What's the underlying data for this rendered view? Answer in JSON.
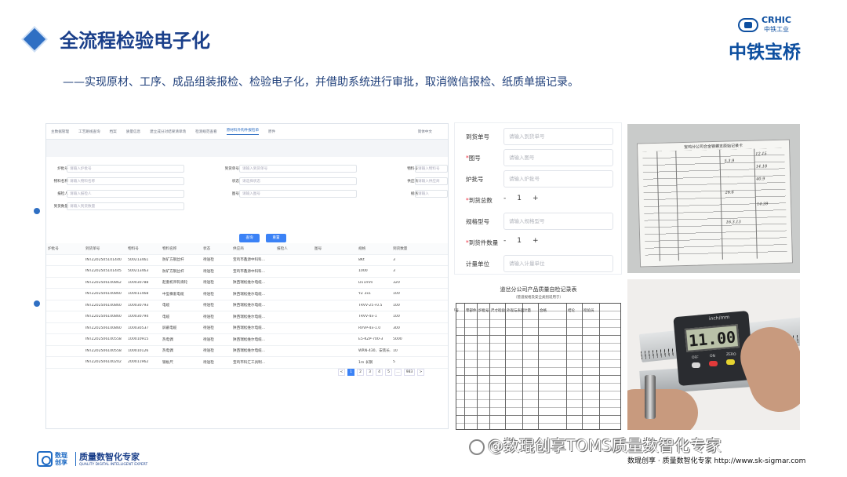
{
  "header": {
    "title": "全流程检验电子化",
    "subtitle": "——实现原材、工序、成品组装报检、检验电子化，并借助系统进行审批，取消微信报检、纸质单据记录。",
    "logo": {
      "crhic": "CRHIC",
      "crhic_sub": "中铁工业",
      "brand": "中铁宝桥"
    }
  },
  "system_panel": {
    "tabs": [
      "主数据管理",
      "工艺路线查询",
      "档案",
      "质量信息",
      "建立成分对结果清单场",
      "检测规范查看",
      "原材料外购件报检单",
      "原件"
    ],
    "active_tab": 6,
    "user": "简体中文",
    "filters": [
      {
        "label": "炉批号",
        "placeholder": "请输入炉批号"
      },
      {
        "label": "到货单号",
        "placeholder": "请输入到货单号"
      },
      {
        "label": "物料号",
        "placeholder": "请输入物料号"
      },
      {
        "label": "物料名称",
        "placeholder": "请输入物料名称"
      },
      {
        "label": "状态",
        "placeholder": "请选择状态"
      },
      {
        "label": "供应商",
        "placeholder": "请输入供应商"
      },
      {
        "label": "报检人",
        "placeholder": "请输入报检人"
      },
      {
        "label": "图号",
        "placeholder": "请输入图号"
      },
      {
        "label": "规格",
        "placeholder": "请输入"
      },
      {
        "label": "到货数量",
        "placeholder": "请输入到货数量"
      }
    ],
    "buttons": {
      "search": "查询",
      "reset": "重置"
    },
    "columns": [
      "炉批号",
      "到货单号",
      "物料号",
      "物料名称",
      "状态",
      "供应商",
      "报检人",
      "图号",
      "规格",
      "到货数量"
    ],
    "rows": [
      [
        "",
        "INTZ202505101440",
        "500213461",
        "防矿方钢丝杆",
        "待送检",
        "宝鸡市鑫源中科科...",
        "",
        "",
        "8Kt",
        "3"
      ],
      [
        "",
        "INTZ202505101445",
        "500213463",
        "防矿方钢丝杆",
        "待送检",
        "宝鸡市鑫源中科科...",
        "",
        "",
        "1000",
        "3"
      ],
      [
        "",
        "INTZ202506100862",
        "100030788",
        "起重机吊钩滑轮",
        "待送检",
        "陕西瑞松维尔电缆...",
        "",
        "",
        "D11mm",
        "320"
      ],
      [
        "",
        "INTZ202506100860",
        "100011468",
        "中型橡套电缆",
        "待送检",
        "陕西瑞松维尔电缆...",
        "",
        "",
        "YZ 3x1",
        "100"
      ],
      [
        "",
        "INTZ202506100860",
        "100030793",
        "电缆",
        "待送检",
        "陕西瑞松维尔电缆...",
        "",
        "",
        "TRVV-25+0.5",
        "100"
      ],
      [
        "",
        "INTZ202506100860",
        "100030794",
        "电缆",
        "待送检",
        "陕西瑞松维尔电缆...",
        "",
        "",
        "TRVV-4x-1",
        "100"
      ],
      [
        "",
        "INTZ202506100860",
        "100030537",
        "屏蔽电缆",
        "待送检",
        "陕西瑞松维尔电缆...",
        "",
        "",
        "RVVP-4x-1.0",
        "300"
      ],
      [
        "",
        "INTZ202506100558",
        "100010915",
        "热电偶",
        "待送检",
        "陕西瑞松维尔电缆...",
        "",
        "",
        "E5-KZP-700-3",
        "5000"
      ],
      [
        "",
        "INTZ202506100558",
        "100010126",
        "热电偶",
        "待送检",
        "陕西瑞松维尔电缆...",
        "",
        "",
        "WRN-430、安装长...",
        "10"
      ],
      [
        "",
        "INTZ202506100202",
        "200011962",
        "钢板尺",
        "待送检",
        "宝鸡市科汇工具制...",
        "",
        "",
        "1m 长钢",
        "5"
      ]
    ],
    "pagination": [
      "<",
      "1",
      "2",
      "3",
      "4",
      "5",
      "…",
      "983",
      ">"
    ],
    "active_page": 1
  },
  "form_panel": {
    "fields": [
      {
        "label": "到货单号",
        "required": false,
        "placeholder": "请输入到货单号"
      },
      {
        "label": "图号",
        "required": true,
        "placeholder": "请输入图号"
      },
      {
        "label": "炉批号",
        "required": false,
        "placeholder": "请输入炉批号"
      },
      {
        "label": "到货总数",
        "required": true,
        "stepper": {
          "minus": "-",
          "value": "1",
          "plus": "+"
        }
      },
      {
        "label": "规格型号",
        "required": false,
        "placeholder": "请输入规格型号"
      },
      {
        "label": "到货件数量",
        "required": true,
        "stepper": {
          "minus": "-",
          "value": "1",
          "plus": "+"
        }
      },
      {
        "label": "计量单位",
        "required": false,
        "placeholder": "请输入计量单位"
      }
    ]
  },
  "paper_doc1": {
    "title": "宝鸡分公司合金钢螺支原始记录卡",
    "handwriting": [
      "12.15",
      "5.3.9",
      "14.18",
      "40.9",
      "26.6",
      "14.39",
      "16.3.13"
    ]
  },
  "paper_doc2": {
    "title": "道岔分公司产品质量自检记录表",
    "subtitle": "（管道规格及安全类别适用于）",
    "headers": [
      "序号",
      "零部件",
      "炉批号",
      "尺寸检验",
      "外观与表面",
      "计量",
      "合格",
      "结论",
      "检验员"
    ]
  },
  "caliper_photo": {
    "reading": "11.00",
    "unit": "inch/mm",
    "buttons": [
      "OFF",
      "ON",
      "ZERO"
    ]
  },
  "footer": {
    "logo_cn_line1": "数琨",
    "logo_cn_line2": "创享",
    "logo_main": "质量数智化专家",
    "logo_en": "QUALITY DIGITAL INTELLIGENT EXPERT",
    "watermark": "@数琨创享TOMS质量数智化专家",
    "right_text": "数琨创享 · 质量数智化专家    http://www.sk-sigmar.com"
  },
  "colors": {
    "accent": "#2f6fc3",
    "title": "#1a3f8a",
    "primary_button": "#3b82f6"
  }
}
